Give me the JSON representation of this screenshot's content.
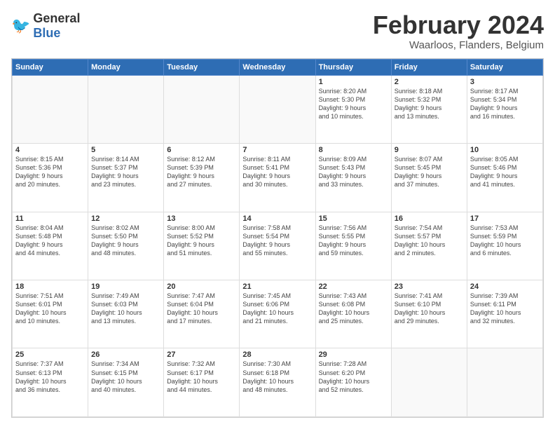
{
  "logo": {
    "general": "General",
    "blue": "Blue"
  },
  "title": "February 2024",
  "location": "Waarloos, Flanders, Belgium",
  "days_of_week": [
    "Sunday",
    "Monday",
    "Tuesday",
    "Wednesday",
    "Thursday",
    "Friday",
    "Saturday"
  ],
  "weeks": [
    [
      {
        "day": "",
        "info": ""
      },
      {
        "day": "",
        "info": ""
      },
      {
        "day": "",
        "info": ""
      },
      {
        "day": "",
        "info": ""
      },
      {
        "day": "1",
        "info": "Sunrise: 8:20 AM\nSunset: 5:30 PM\nDaylight: 9 hours\nand 10 minutes."
      },
      {
        "day": "2",
        "info": "Sunrise: 8:18 AM\nSunset: 5:32 PM\nDaylight: 9 hours\nand 13 minutes."
      },
      {
        "day": "3",
        "info": "Sunrise: 8:17 AM\nSunset: 5:34 PM\nDaylight: 9 hours\nand 16 minutes."
      }
    ],
    [
      {
        "day": "4",
        "info": "Sunrise: 8:15 AM\nSunset: 5:36 PM\nDaylight: 9 hours\nand 20 minutes."
      },
      {
        "day": "5",
        "info": "Sunrise: 8:14 AM\nSunset: 5:37 PM\nDaylight: 9 hours\nand 23 minutes."
      },
      {
        "day": "6",
        "info": "Sunrise: 8:12 AM\nSunset: 5:39 PM\nDaylight: 9 hours\nand 27 minutes."
      },
      {
        "day": "7",
        "info": "Sunrise: 8:11 AM\nSunset: 5:41 PM\nDaylight: 9 hours\nand 30 minutes."
      },
      {
        "day": "8",
        "info": "Sunrise: 8:09 AM\nSunset: 5:43 PM\nDaylight: 9 hours\nand 33 minutes."
      },
      {
        "day": "9",
        "info": "Sunrise: 8:07 AM\nSunset: 5:45 PM\nDaylight: 9 hours\nand 37 minutes."
      },
      {
        "day": "10",
        "info": "Sunrise: 8:05 AM\nSunset: 5:46 PM\nDaylight: 9 hours\nand 41 minutes."
      }
    ],
    [
      {
        "day": "11",
        "info": "Sunrise: 8:04 AM\nSunset: 5:48 PM\nDaylight: 9 hours\nand 44 minutes."
      },
      {
        "day": "12",
        "info": "Sunrise: 8:02 AM\nSunset: 5:50 PM\nDaylight: 9 hours\nand 48 minutes."
      },
      {
        "day": "13",
        "info": "Sunrise: 8:00 AM\nSunset: 5:52 PM\nDaylight: 9 hours\nand 51 minutes."
      },
      {
        "day": "14",
        "info": "Sunrise: 7:58 AM\nSunset: 5:54 PM\nDaylight: 9 hours\nand 55 minutes."
      },
      {
        "day": "15",
        "info": "Sunrise: 7:56 AM\nSunset: 5:55 PM\nDaylight: 9 hours\nand 59 minutes."
      },
      {
        "day": "16",
        "info": "Sunrise: 7:54 AM\nSunset: 5:57 PM\nDaylight: 10 hours\nand 2 minutes."
      },
      {
        "day": "17",
        "info": "Sunrise: 7:53 AM\nSunset: 5:59 PM\nDaylight: 10 hours\nand 6 minutes."
      }
    ],
    [
      {
        "day": "18",
        "info": "Sunrise: 7:51 AM\nSunset: 6:01 PM\nDaylight: 10 hours\nand 10 minutes."
      },
      {
        "day": "19",
        "info": "Sunrise: 7:49 AM\nSunset: 6:03 PM\nDaylight: 10 hours\nand 13 minutes."
      },
      {
        "day": "20",
        "info": "Sunrise: 7:47 AM\nSunset: 6:04 PM\nDaylight: 10 hours\nand 17 minutes."
      },
      {
        "day": "21",
        "info": "Sunrise: 7:45 AM\nSunset: 6:06 PM\nDaylight: 10 hours\nand 21 minutes."
      },
      {
        "day": "22",
        "info": "Sunrise: 7:43 AM\nSunset: 6:08 PM\nDaylight: 10 hours\nand 25 minutes."
      },
      {
        "day": "23",
        "info": "Sunrise: 7:41 AM\nSunset: 6:10 PM\nDaylight: 10 hours\nand 29 minutes."
      },
      {
        "day": "24",
        "info": "Sunrise: 7:39 AM\nSunset: 6:11 PM\nDaylight: 10 hours\nand 32 minutes."
      }
    ],
    [
      {
        "day": "25",
        "info": "Sunrise: 7:37 AM\nSunset: 6:13 PM\nDaylight: 10 hours\nand 36 minutes."
      },
      {
        "day": "26",
        "info": "Sunrise: 7:34 AM\nSunset: 6:15 PM\nDaylight: 10 hours\nand 40 minutes."
      },
      {
        "day": "27",
        "info": "Sunrise: 7:32 AM\nSunset: 6:17 PM\nDaylight: 10 hours\nand 44 minutes."
      },
      {
        "day": "28",
        "info": "Sunrise: 7:30 AM\nSunset: 6:18 PM\nDaylight: 10 hours\nand 48 minutes."
      },
      {
        "day": "29",
        "info": "Sunrise: 7:28 AM\nSunset: 6:20 PM\nDaylight: 10 hours\nand 52 minutes."
      },
      {
        "day": "",
        "info": ""
      },
      {
        "day": "",
        "info": ""
      }
    ]
  ]
}
